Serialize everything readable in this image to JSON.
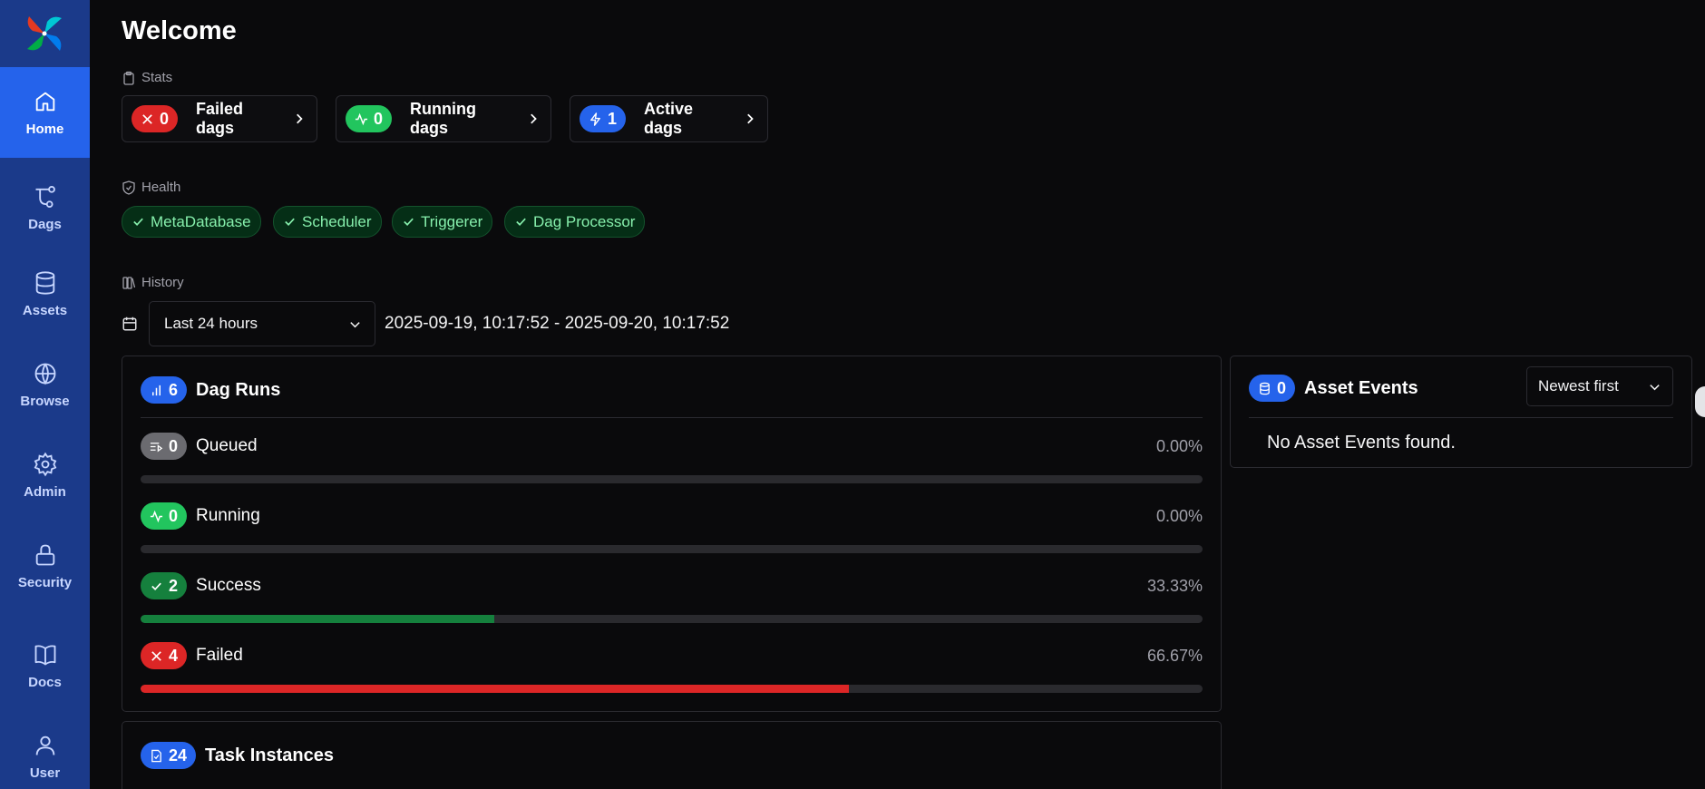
{
  "sidebar": {
    "items": [
      {
        "label": "Home",
        "icon": "home-icon"
      },
      {
        "label": "Dags",
        "icon": "dags-icon"
      },
      {
        "label": "Assets",
        "icon": "database-icon"
      },
      {
        "label": "Browse",
        "icon": "globe-icon"
      },
      {
        "label": "Admin",
        "icon": "gear-icon"
      },
      {
        "label": "Security",
        "icon": "lock-icon"
      },
      {
        "label": "Docs",
        "icon": "book-icon"
      },
      {
        "label": "User",
        "icon": "user-icon"
      }
    ]
  },
  "page": {
    "title": "Welcome"
  },
  "stats": {
    "section_label": "Stats",
    "failed": {
      "count": "0",
      "label": "Failed dags"
    },
    "running": {
      "count": "0",
      "label": "Running dags"
    },
    "active": {
      "count": "1",
      "label": "Active dags"
    }
  },
  "health": {
    "section_label": "Health",
    "items": [
      "MetaDatabase",
      "Scheduler",
      "Triggerer",
      "Dag Processor"
    ]
  },
  "history": {
    "section_label": "History",
    "range_select": "Last 24 hours",
    "range_text": "2025-09-19, 10:17:52 - 2025-09-20, 10:17:52"
  },
  "dag_runs": {
    "count": "6",
    "title": "Dag Runs",
    "rows": [
      {
        "label": "Queued",
        "count": "0",
        "pct": "0.00%",
        "fraction": 0.0,
        "color": "#9ca3af"
      },
      {
        "label": "Running",
        "count": "0",
        "pct": "0.00%",
        "fraction": 0.0,
        "color": "#22c55e"
      },
      {
        "label": "Success",
        "count": "2",
        "pct": "33.33%",
        "fraction": 0.3333,
        "color": "#15803d"
      },
      {
        "label": "Failed",
        "count": "4",
        "pct": "66.67%",
        "fraction": 0.6667,
        "color": "#dc2626"
      }
    ]
  },
  "asset_events": {
    "count": "0",
    "title": "Asset Events",
    "sort": "Newest first",
    "empty": "No Asset Events found."
  },
  "task_instances": {
    "count": "24",
    "title": "Task Instances"
  },
  "colors": {
    "accent": "#2563eb",
    "sidebar": "#1b3a8a",
    "success": "#15803d",
    "failed": "#dc2626",
    "running": "#22c55e"
  }
}
